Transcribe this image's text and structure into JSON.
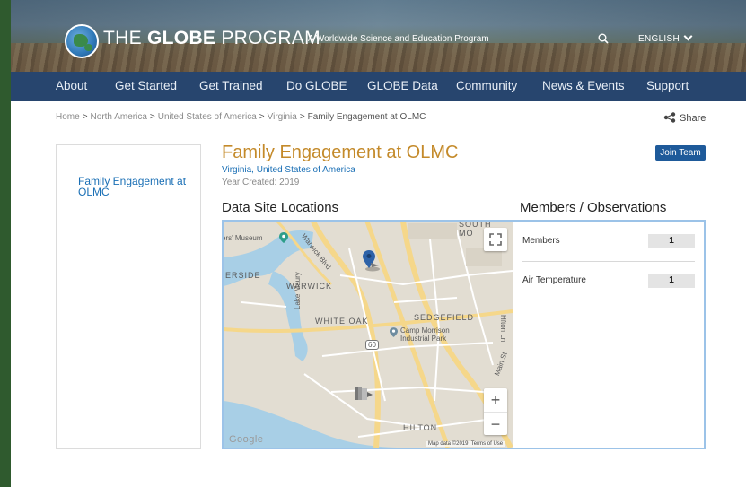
{
  "header": {
    "logo_prefix": "THE",
    "logo_bold": "GLOBE",
    "logo_suffix": "PROGRAM",
    "tagline": "A Worldwide Science and Education Program",
    "language": "ENGLISH"
  },
  "nav": {
    "items": [
      "About",
      "Get Started",
      "Get Trained",
      "Do GLOBE",
      "GLOBE Data",
      "Community",
      "News & Events",
      "Support"
    ]
  },
  "breadcrumb": {
    "items": [
      "Home",
      "North America",
      "United States of America",
      "Virginia"
    ],
    "current": "Family Engagement at OLMC",
    "separator": ">"
  },
  "share_label": "Share",
  "sidebar": {
    "link": "Family Engagement at OLMC"
  },
  "team": {
    "title": "Family Engagement at OLMC",
    "location_state": "Virginia",
    "location_country": "United States of America",
    "year_created": "Year Created: 2019",
    "join_label": "Join Team"
  },
  "sections": {
    "data_sites": "Data Site Locations",
    "members_obs": "Members / Observations"
  },
  "map": {
    "labels": {
      "museum": "ers' Museum",
      "warwick_blvd": "Warwick Blvd",
      "riverside": "ERSIDE",
      "warwick": "WARWICK",
      "lake_maury": "Lake Maury",
      "white_oak": "WHITE OAK",
      "sedgefield": "SEDGEFIELD",
      "camp_morrison": "Camp Morrison",
      "industrial_park": "Industrial Park",
      "hilton": "HILTON",
      "south": "SOUTH",
      "mo": "MO",
      "route": "60",
      "main_st": "Main St",
      "hfton": "Hfton Ln"
    },
    "zoom_in": "+",
    "zoom_out": "−",
    "google": "Google",
    "attribution": "Map data ©2019",
    "terms": "Terms of Use"
  },
  "members": [
    {
      "label": "Members",
      "count": "1"
    },
    {
      "label": "Air Temperature",
      "count": "1"
    }
  ],
  "colors": {
    "nav_bg": "#27456e",
    "title": "#c48a2a",
    "link": "#1a6fb5",
    "join_bg": "#1e5a9a",
    "panel_border": "#9cc3e8"
  },
  "icons": {
    "search": "search-icon",
    "chevron": "chevron-down-icon",
    "share": "share-icon",
    "fullscreen": "fullscreen-icon",
    "marker": "map-marker-icon",
    "site": "data-site-icon",
    "place": "place-pin-icon"
  }
}
